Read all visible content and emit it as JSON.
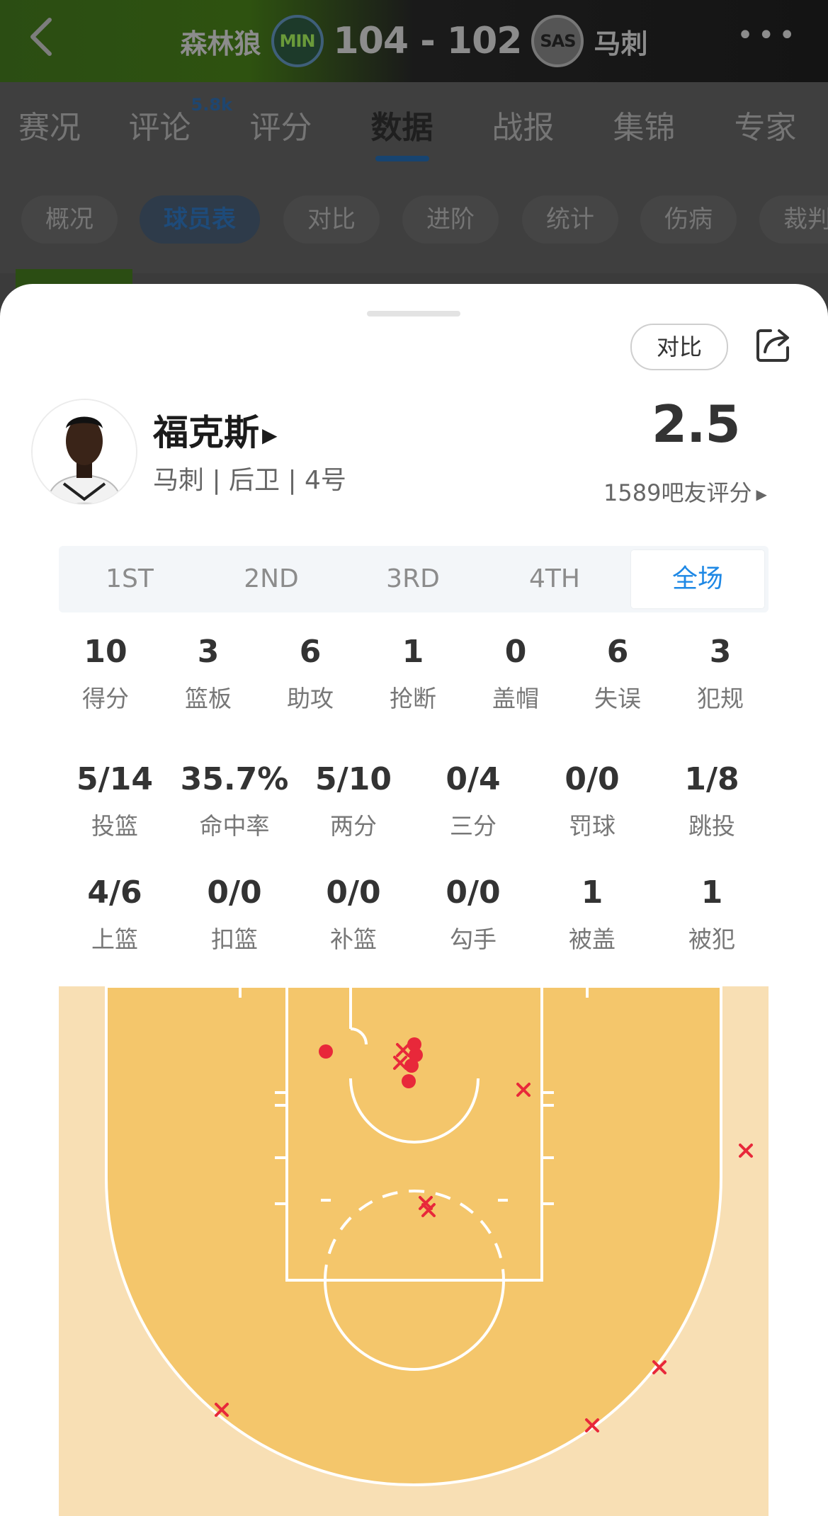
{
  "header": {
    "home_team": "森林狼",
    "home_abbr": "MIN",
    "score": "104 - 102",
    "away_abbr": "SAS",
    "away_team": "马刺",
    "more": "•••"
  },
  "tabs": [
    {
      "label": "赛况"
    },
    {
      "label": "评论",
      "badge": "5.8k"
    },
    {
      "label": "评分"
    },
    {
      "label": "数据",
      "active": true
    },
    {
      "label": "战报"
    },
    {
      "label": "集锦"
    },
    {
      "label": "专家"
    }
  ],
  "chips": [
    "概况",
    "球员表",
    "对比",
    "进阶",
    "统计",
    "伤病",
    "裁判"
  ],
  "active_chip": "球员表",
  "sheet": {
    "compare_label": "对比",
    "player": {
      "name": "福克斯",
      "meta": "马刺 | 后卫 | 4号"
    },
    "rating": "2.5",
    "rating_count": "1589吧友评分",
    "quarters": [
      "1ST",
      "2ND",
      "3RD",
      "4TH",
      "全场"
    ],
    "active_quarter": "全场",
    "row1": [
      {
        "value": "10",
        "label": "得分"
      },
      {
        "value": "3",
        "label": "篮板"
      },
      {
        "value": "6",
        "label": "助攻"
      },
      {
        "value": "1",
        "label": "抢断"
      },
      {
        "value": "0",
        "label": "盖帽"
      },
      {
        "value": "6",
        "label": "失误"
      },
      {
        "value": "3",
        "label": "犯规"
      }
    ],
    "row2": [
      {
        "value": "5/14",
        "label": "投篮"
      },
      {
        "value": "35.7%",
        "label": "命中率"
      },
      {
        "value": "5/10",
        "label": "两分"
      },
      {
        "value": "0/4",
        "label": "三分"
      },
      {
        "value": "0/0",
        "label": "罚球"
      },
      {
        "value": "1/8",
        "label": "跳投"
      }
    ],
    "row3": [
      {
        "value": "4/6",
        "label": "上篮"
      },
      {
        "value": "0/0",
        "label": "扣篮"
      },
      {
        "value": "0/0",
        "label": "补篮"
      },
      {
        "value": "0/0",
        "label": "勾手"
      },
      {
        "value": "1",
        "label": "被盖"
      },
      {
        "value": "1",
        "label": "被犯"
      }
    ]
  },
  "colors": {
    "accent": "#1e88e5",
    "court_paint": "#f4c66b",
    "court_outer": "#f8dfb4",
    "made": "#e8283a",
    "missed": "#e8283a"
  },
  "icons": [
    "back-arrow-icon",
    "more-icon",
    "share-icon",
    "triangle-right-icon"
  ]
}
